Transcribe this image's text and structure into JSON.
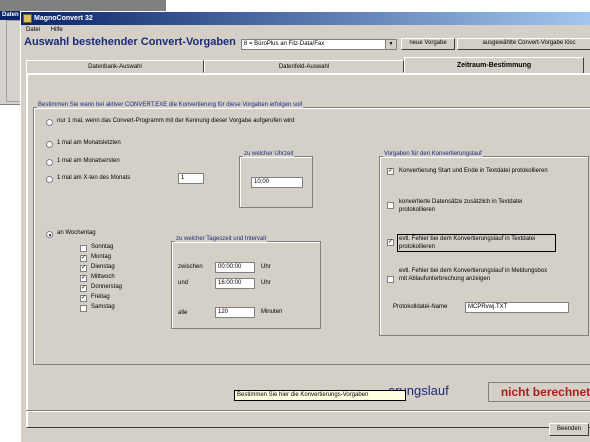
{
  "background_window": {
    "caption": "Daten"
  },
  "window": {
    "title": "MagnoConvert 32",
    "menu": [
      "Datei",
      "Hilfe"
    ]
  },
  "header": {
    "heading": "Auswahl bestehender Convert-Vorgaben",
    "selected_vorgabe": "8 = BüroPlus an Filz-Data/Fax",
    "btn_neue": "neue Vorgabe",
    "btn_ausgewaehlte": "ausgewählte Convert-Vorgabe lösc"
  },
  "tabs": [
    "Datenbank-Auswahl",
    "Datenfeld-Auswahl",
    "Zeitraum-Bestimmung"
  ],
  "panel": {
    "intro": "Bestimmen Sie wann bei aktiver CONVERT.EXE die Konvertierung für diese Vorgaben erfolgen soll",
    "radio_1mal": "nur 1 mal, wenn das Convert-Programm mit der Kennung dieser Vorgabe aufgerufen wird",
    "radio_letzten": "1 mal am Monatsletzten",
    "radio_ersten": "1 mal am Monatsersten",
    "radio_xten": "1 mal am X-ten des Monats",
    "xten_value": "1",
    "uhrzeit_label": "zu welcher Uhrzeit",
    "uhrzeit_value": "10:00",
    "radio_wochentag": "an Wochentag",
    "days": [
      {
        "label": "Sonntag",
        "checked": false
      },
      {
        "label": "Montag",
        "checked": true
      },
      {
        "label": "Dienstag",
        "checked": true
      },
      {
        "label": "Mittwoch",
        "checked": true
      },
      {
        "label": "Donnerstag",
        "checked": true
      },
      {
        "label": "Freitag",
        "checked": true
      },
      {
        "label": "Samstag",
        "checked": false
      }
    ],
    "intervall_label": "zu welcher Tageszeit und Intervall",
    "zwischen": "zwischen",
    "und": "und",
    "alle": "alle",
    "time_from": "00:00:00",
    "time_to": "16:00:00",
    "uhr1": "Uhr",
    "uhr2": "Uhr",
    "interval_value": "120",
    "minuten": "Minuten",
    "vorgaben_label": "Vorgaben für den Konvertierungslauf",
    "opt1": "Konvertierung Start und Ende in Textdatei protokollieren",
    "opt2": "konvertierte Datensätze zusätzlich in Textdatei protokollieren",
    "opt3": "evtl. Fehler bei dem Konvertierungslauf in Textdatei protokollieren",
    "opt4": "evtl. Fehler bei dem Konvertierungslauf in Meldungsbox mit Ablaufunterbrechung anzeigen",
    "protokoll_label": "Protokolldatei-Name",
    "protokoll_value": "MCPRvwj.TXT"
  },
  "status": {
    "lauf": "erungslauf",
    "berechnet": "nicht berechnet",
    "tooltip": "Bestimmen Sie hier die Konvertierungs-Vorgaben"
  },
  "footer": {
    "beenden": "Beenden"
  }
}
